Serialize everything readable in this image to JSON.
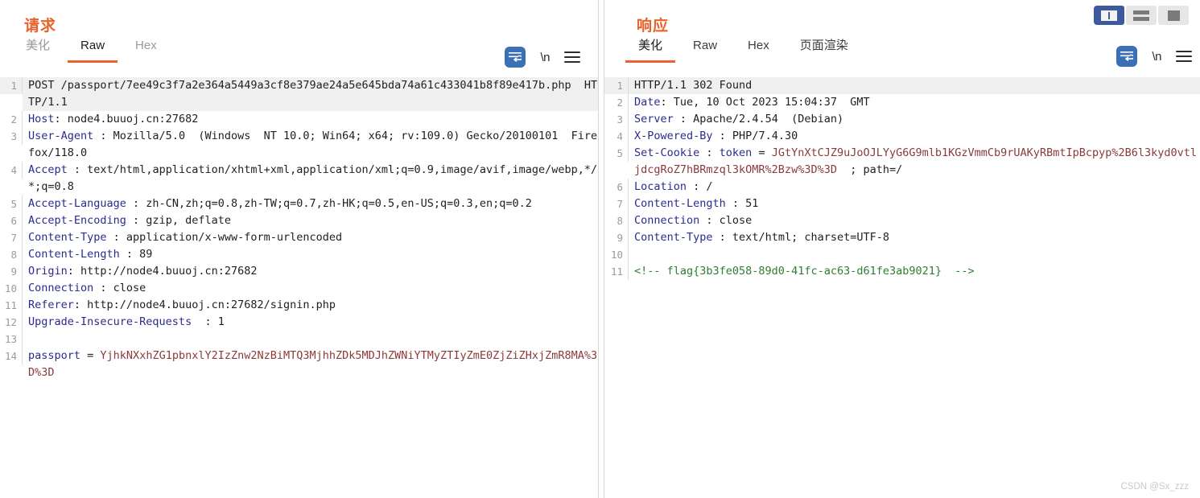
{
  "layout_switch": {
    "buttons": [
      {
        "name": "split-vertical",
        "label": "",
        "active": true
      },
      {
        "name": "split-horizontal",
        "label": "",
        "active": false
      },
      {
        "name": "single-pane",
        "label": "",
        "active": false
      }
    ]
  },
  "request": {
    "title": "请求",
    "tabs": [
      {
        "label": "美化",
        "active": false
      },
      {
        "label": "Raw",
        "active": true
      },
      {
        "label": "Hex",
        "active": false
      }
    ],
    "toolbar": {
      "wrap_icon": "word-wrap-icon",
      "newline_label": "\\n",
      "menu_icon": "hamburger-menu-icon"
    },
    "lines": [
      {
        "n": "1",
        "segments": [
          {
            "t": "POST /passport/7ee49c3f7a2e364a5449a3cf8e379ae24a5e645bda74a61c433041b8f89e417b.php  HTTP/1.1",
            "c": "plain"
          }
        ]
      },
      {
        "n": "2",
        "segments": [
          {
            "t": "Host",
            "c": "k"
          },
          {
            "t": ": node4.buuoj.cn:27682",
            "c": "v"
          }
        ]
      },
      {
        "n": "3",
        "segments": [
          {
            "t": "User-Agent",
            "c": "k"
          },
          {
            "t": " : Mozilla/5.0  (Windows  NT 10.0; Win64; x64; rv:109.0) Gecko/20100101  Firefox/118.0",
            "c": "v"
          }
        ]
      },
      {
        "n": "4",
        "segments": [
          {
            "t": "Accept",
            "c": "k"
          },
          {
            "t": " : text/html,application/xhtml+xml,application/xml;q=0.9,image/avif,image/webp,*/*;q=0.8",
            "c": "v"
          }
        ]
      },
      {
        "n": "5",
        "segments": [
          {
            "t": "Accept-Language",
            "c": "k"
          },
          {
            "t": " : zh-CN,zh;q=0.8,zh-TW;q=0.7,zh-HK;q=0.5,en-US;q=0.3,en;q=0.2",
            "c": "v"
          }
        ]
      },
      {
        "n": "6",
        "segments": [
          {
            "t": "Accept-Encoding",
            "c": "k"
          },
          {
            "t": " : gzip, deflate",
            "c": "v"
          }
        ]
      },
      {
        "n": "7",
        "segments": [
          {
            "t": "Content-Type",
            "c": "k"
          },
          {
            "t": " : application/x-www-form-urlencoded",
            "c": "v"
          }
        ]
      },
      {
        "n": "8",
        "segments": [
          {
            "t": "Content-Length",
            "c": "k"
          },
          {
            "t": " : 89",
            "c": "v"
          }
        ]
      },
      {
        "n": "9",
        "segments": [
          {
            "t": "Origin",
            "c": "k"
          },
          {
            "t": ": http://node4.buuoj.cn:27682",
            "c": "v"
          }
        ]
      },
      {
        "n": "10",
        "segments": [
          {
            "t": "Connection",
            "c": "k"
          },
          {
            "t": " : close",
            "c": "v"
          }
        ]
      },
      {
        "n": "11",
        "segments": [
          {
            "t": "Referer",
            "c": "k"
          },
          {
            "t": ": http://node4.buuoj.cn:27682/signin.php",
            "c": "v"
          }
        ]
      },
      {
        "n": "12",
        "segments": [
          {
            "t": "Upgrade-Insecure-Requests",
            "c": "k"
          },
          {
            "t": "  : 1",
            "c": "v"
          }
        ]
      },
      {
        "n": "13",
        "segments": [
          {
            "t": "",
            "c": "plain"
          }
        ]
      },
      {
        "n": "14",
        "segments": [
          {
            "t": "passport",
            "c": "k"
          },
          {
            "t": " = ",
            "c": "v"
          },
          {
            "t": "YjhkNXxhZG1pbnxlY2IzZnw2NzBiMTQ3MjhhZDk5MDJhZWNiYTMyZTIyZmE0ZjZiZHxjZmR8MA%3D%3D",
            "c": "s"
          }
        ]
      }
    ]
  },
  "response": {
    "title": "响应",
    "tabs": [
      {
        "label": "美化",
        "active": true
      },
      {
        "label": "Raw",
        "active": false
      },
      {
        "label": "Hex",
        "active": false
      },
      {
        "label": "页面渲染",
        "active": false
      }
    ],
    "toolbar": {
      "wrap_icon": "word-wrap-icon",
      "newline_label": "\\n",
      "menu_icon": "hamburger-menu-icon"
    },
    "lines": [
      {
        "n": "1",
        "segments": [
          {
            "t": "HTTP/1.1 302 Found",
            "c": "plain"
          }
        ]
      },
      {
        "n": "2",
        "segments": [
          {
            "t": "Date",
            "c": "k"
          },
          {
            "t": ": Tue, 10 Oct 2023 15:04:37  GMT",
            "c": "v"
          }
        ]
      },
      {
        "n": "3",
        "segments": [
          {
            "t": "Server",
            "c": "k"
          },
          {
            "t": " : Apache/2.4.54  (Debian)",
            "c": "v"
          }
        ]
      },
      {
        "n": "4",
        "segments": [
          {
            "t": "X-Powered-By",
            "c": "k"
          },
          {
            "t": " : PHP/7.4.30",
            "c": "v"
          }
        ]
      },
      {
        "n": "5",
        "segments": [
          {
            "t": "Set-Cookie",
            "c": "k"
          },
          {
            "t": " : ",
            "c": "v"
          },
          {
            "t": "token",
            "c": "k"
          },
          {
            "t": " = ",
            "c": "v"
          },
          {
            "t": "JGtYnXtCJZ9uJoOJLYyG6G9mlb1KGzVmmCb9rUAKyRBmtIpBcpyp%2B6l3kyd0vtljdcgRoZ7hBRmzql3kOMR%2Bzw%3D%3D",
            "c": "s"
          },
          {
            "t": "  ; path=/",
            "c": "v"
          }
        ]
      },
      {
        "n": "6",
        "segments": [
          {
            "t": "Location",
            "c": "k"
          },
          {
            "t": " : /",
            "c": "v"
          }
        ]
      },
      {
        "n": "7",
        "segments": [
          {
            "t": "Content-Length",
            "c": "k"
          },
          {
            "t": " : 51",
            "c": "v"
          }
        ]
      },
      {
        "n": "8",
        "segments": [
          {
            "t": "Connection",
            "c": "k"
          },
          {
            "t": " : close",
            "c": "v"
          }
        ]
      },
      {
        "n": "9",
        "segments": [
          {
            "t": "Content-Type",
            "c": "k"
          },
          {
            "t": " : text/html; charset=UTF-8",
            "c": "v"
          }
        ]
      },
      {
        "n": "10",
        "segments": [
          {
            "t": "",
            "c": "plain"
          }
        ]
      },
      {
        "n": "11",
        "segments": [
          {
            "t": "<!-- flag{3b3fe058-89d0-41fc-ac63-d61fe3ab9021}  -->",
            "c": "g"
          }
        ]
      }
    ]
  },
  "watermark": "CSDN @Sx_zzz",
  "colors": {
    "accent_orange": "#e8622a",
    "header_blue": "#2b2b8f",
    "string_red": "#8b3a3a",
    "flag_green": "#2e7d32",
    "active_button_blue": "#3b6fb6",
    "layout_active_blue": "#3d5a9e"
  }
}
